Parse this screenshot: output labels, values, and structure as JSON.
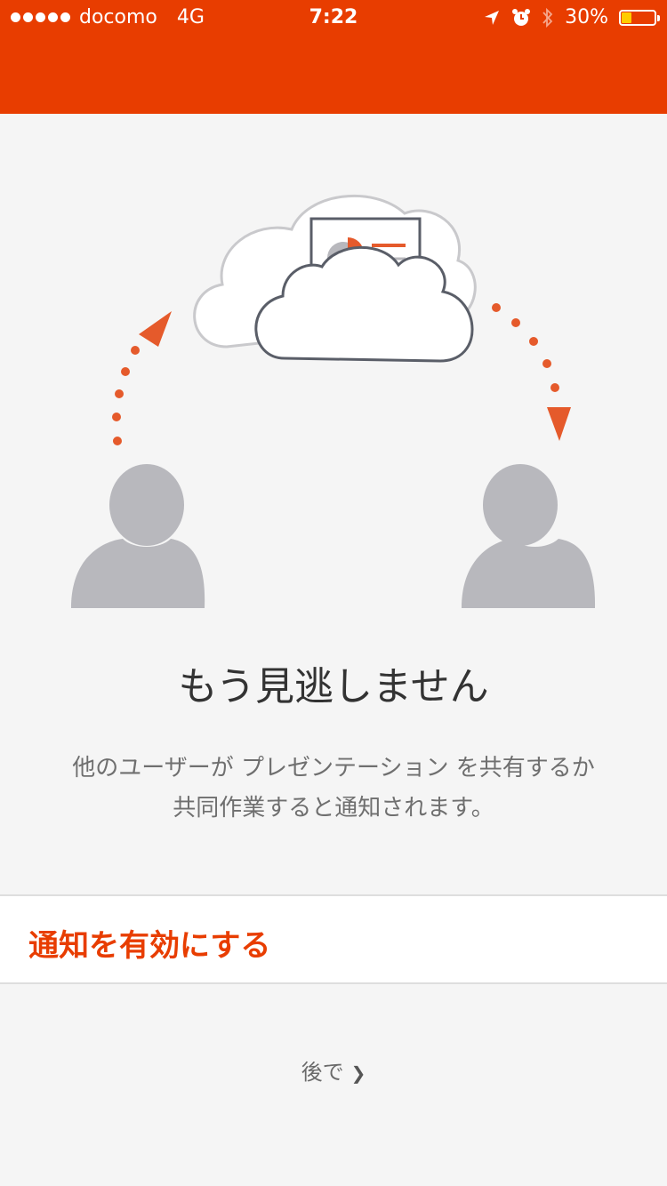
{
  "status_bar": {
    "carrier": "docomo",
    "network": "4G",
    "time": "7:22",
    "battery_percent": "30%",
    "battery_level": 0.3,
    "icons": [
      "location-arrow-icon",
      "alarm-icon",
      "bluetooth-icon",
      "battery-icon"
    ]
  },
  "colors": {
    "accent": "#e83d00",
    "background": "#f5f5f5",
    "person": "#b8b8bd",
    "cloud_outline": "#5a5e68"
  },
  "main": {
    "title": "もう見逃しません",
    "description_line1": "他のユーザーが プレゼンテーション を共有するか",
    "description_line2": "共同作業すると通知されます。",
    "enable_label": "通知を有効にする",
    "later_label": "後で",
    "later_chevron": "❯"
  }
}
